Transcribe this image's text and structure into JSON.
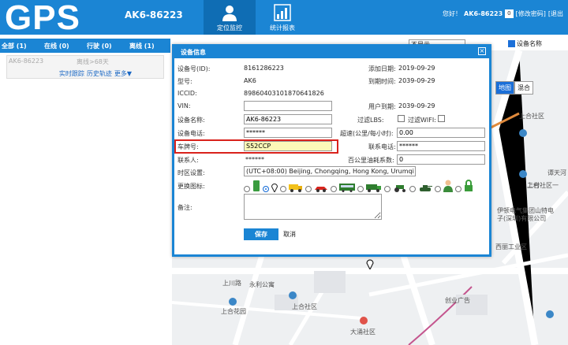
{
  "header": {
    "logo": "GPS",
    "device_name": "AK6-86223",
    "tabs": [
      {
        "label": "定位监控",
        "active": true
      },
      {
        "label": "统计报表",
        "active": false
      }
    ],
    "user": {
      "greeting": "您好！",
      "name": "AK6-86223",
      "lang": "0",
      "change_password": "[修改密码]",
      "logout": "[退出"
    }
  },
  "left_panel": {
    "tabs": [
      "全部 (1)",
      "在线 (0)",
      "行驶 (0)",
      "离线 (1)"
    ],
    "device": {
      "name": "AK6-86223",
      "status": "离线>68天",
      "links": [
        "实时跟踪",
        "历史轨迹",
        "更多▼"
      ]
    }
  },
  "map": {
    "select_value": "不显示",
    "device_name_checkbox": "设备名称",
    "map_types": [
      "地图",
      "混合"
    ],
    "labels": {
      "l1": "上合社区",
      "l2": "上合社区一",
      "l3": "伊顿电气集团山特电",
      "l4": "子(深圳)有限公司",
      "l5": "上川路",
      "l6": "永利公寓",
      "l7": "上合社区",
      "l8": "上合花园",
      "l9": "创业广告",
      "l10": "大涌社区",
      "l11": "谭天河",
      "l12": "二村",
      "l13": "西丽工业区"
    }
  },
  "dialog": {
    "title": "设备信息",
    "close": "×",
    "fields": {
      "device_id_label": "设备号(ID):",
      "device_id": "8161286223",
      "model_label": "型号:",
      "model": "AK6",
      "iccid_label": "ICCID:",
      "iccid": "89860403101870641826",
      "vin_label": "VIN:",
      "vin": "",
      "name_label": "设备名称:",
      "name": "AK6-86223",
      "phone_label": "设备电话:",
      "phone": "******",
      "plate_label": "车牌号:",
      "plate": "S52CCP",
      "contact_label": "联系人:",
      "contact": "******",
      "timezone_label": "时区设置:",
      "timezone": "(UTC+08:00) Beijing, Chongqing, Hong Kong, Urumqi",
      "icon_label": "更换图标:",
      "notes_label": "备注:",
      "add_date_label": "添加日期:",
      "add_date": "2019-09-29",
      "expire_label": "到期时间:",
      "expire": "2039-09-29",
      "user_expire_label": "用户到期:",
      "user_expire": "2039-09-29",
      "filter_lbs": "过滤LBS:",
      "filter_wifi": "过滤WIFI:",
      "speed_label": "超速(公里/每小时):",
      "speed": "0.00",
      "contact_phone_label": "联系电话:",
      "contact_phone": "******",
      "fuel_label": "百公里油耗系数:",
      "fuel": "0"
    },
    "save_label": "保存",
    "cancel_label": "取消"
  },
  "colors": {
    "header_blue": "#1b85d4",
    "highlight_red": "#d9221c",
    "plate_bg": "#fdf9b8"
  }
}
